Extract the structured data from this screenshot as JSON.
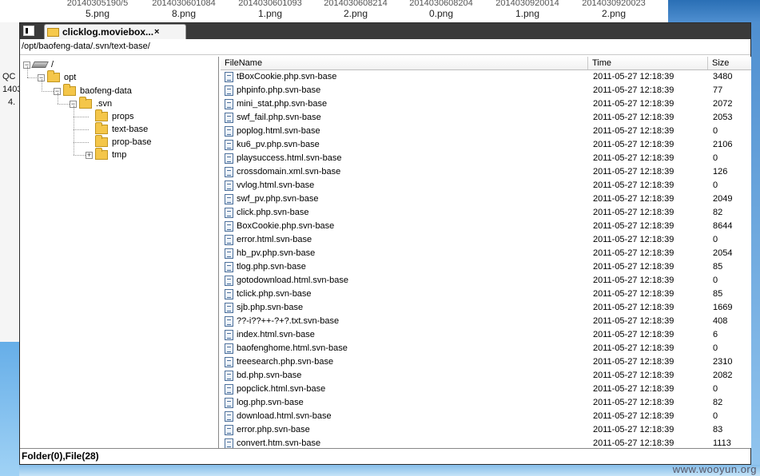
{
  "background": {
    "desktop_icons": [
      {
        "top_name": "20140305190/5",
        "label": "5.png"
      },
      {
        "top_name": "2014030601084",
        "label": "8.png"
      },
      {
        "top_name": "2014030601093",
        "label": "1.png"
      },
      {
        "top_name": "2014030608214",
        "label": "2.png"
      },
      {
        "top_name": "2014030608204",
        "label": "0.png"
      },
      {
        "top_name": "2014030920014",
        "label": "1.png"
      },
      {
        "top_name": "2014030920023",
        "label": "2.png"
      }
    ],
    "left_fragments": [
      "QC",
      "1403",
      "4."
    ],
    "watermark": "www.wooyun.org"
  },
  "window": {
    "tab_title": "clicklog.moviebox...",
    "tab_close": "×",
    "path": "/opt/baofeng-data/.svn/text-base/"
  },
  "tree": [
    {
      "label": "/",
      "kind": "drive",
      "expander": "−"
    },
    {
      "label": "opt",
      "kind": "folder",
      "expander": "−"
    },
    {
      "label": "baofeng-data",
      "kind": "folder",
      "expander": "−"
    },
    {
      "label": ".svn",
      "kind": "folder",
      "expander": "−"
    },
    {
      "label": "props",
      "kind": "folder",
      "expander": ""
    },
    {
      "label": "text-base",
      "kind": "folder",
      "expander": ""
    },
    {
      "label": "prop-base",
      "kind": "folder",
      "expander": ""
    },
    {
      "label": "tmp",
      "kind": "folder",
      "expander": "+"
    }
  ],
  "list": {
    "columns": [
      "FileName",
      "Time",
      "Size"
    ],
    "rows": [
      [
        "tBoxCookie.php.svn-base",
        "2011-05-27 12:18:39",
        "3480"
      ],
      [
        "phpinfo.php.svn-base",
        "2011-05-27 12:18:39",
        "77"
      ],
      [
        "mini_stat.php.svn-base",
        "2011-05-27 12:18:39",
        "2072"
      ],
      [
        "swf_fail.php.svn-base",
        "2011-05-27 12:18:39",
        "2053"
      ],
      [
        "poplog.html.svn-base",
        "2011-05-27 12:18:39",
        "0"
      ],
      [
        "ku6_pv.php.svn-base",
        "2011-05-27 12:18:39",
        "2106"
      ],
      [
        "playsuccess.html.svn-base",
        "2011-05-27 12:18:39",
        "0"
      ],
      [
        "crossdomain.xml.svn-base",
        "2011-05-27 12:18:39",
        "126"
      ],
      [
        "vvlog.html.svn-base",
        "2011-05-27 12:18:39",
        "0"
      ],
      [
        "swf_pv.php.svn-base",
        "2011-05-27 12:18:39",
        "2049"
      ],
      [
        "click.php.svn-base",
        "2011-05-27 12:18:39",
        "82"
      ],
      [
        "BoxCookie.php.svn-base",
        "2011-05-27 12:18:39",
        "8644"
      ],
      [
        "error.html.svn-base",
        "2011-05-27 12:18:39",
        "0"
      ],
      [
        "hb_pv.php.svn-base",
        "2011-05-27 12:18:39",
        "2054"
      ],
      [
        "tlog.php.svn-base",
        "2011-05-27 12:18:39",
        "85"
      ],
      [
        "gotodownload.html.svn-base",
        "2011-05-27 12:18:39",
        "0"
      ],
      [
        "tclick.php.svn-base",
        "2011-05-27 12:18:39",
        "85"
      ],
      [
        "sjb.php.svn-base",
        "2011-05-27 12:18:39",
        "1669"
      ],
      [
        "??-i??++-?+?.txt.svn-base",
        "2011-05-27 12:18:39",
        "408"
      ],
      [
        "index.html.svn-base",
        "2011-05-27 12:18:39",
        "6"
      ],
      [
        "baofenghome.html.svn-base",
        "2011-05-27 12:18:39",
        "0"
      ],
      [
        "treesearch.php.svn-base",
        "2011-05-27 12:18:39",
        "2310"
      ],
      [
        "bd.php.svn-base",
        "2011-05-27 12:18:39",
        "2082"
      ],
      [
        "popclick.html.svn-base",
        "2011-05-27 12:18:39",
        "0"
      ],
      [
        "log.php.svn-base",
        "2011-05-27 12:18:39",
        "82"
      ],
      [
        "download.html.svn-base",
        "2011-05-27 12:18:39",
        "0"
      ],
      [
        "error.php.svn-base",
        "2011-05-27 12:18:39",
        "83"
      ],
      [
        "convert.htm.svn-base",
        "2011-05-27 12:18:39",
        "1113"
      ]
    ]
  },
  "status": "Folder(0),File(28)"
}
